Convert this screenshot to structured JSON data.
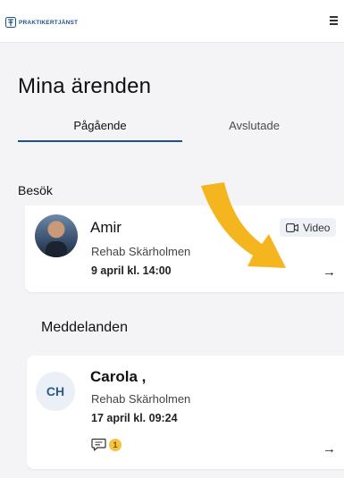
{
  "brand": {
    "name": "PRAKTIKERTJÄNST"
  },
  "page": {
    "title": "Mina ärenden"
  },
  "tabs": [
    {
      "label": "Pågående",
      "active": true
    },
    {
      "label": "Avslutade",
      "active": false
    }
  ],
  "visits": {
    "heading": "Besök",
    "items": [
      {
        "name": "Amir",
        "clinic": "Rehab Skärholmen",
        "datetime": "9 april kl. 14:00",
        "badge": "Video",
        "arrow": "→"
      }
    ]
  },
  "messages": {
    "heading": "Meddelanden",
    "items": [
      {
        "initials": "CH",
        "name": "Carola ,",
        "clinic": "Rehab Skärholmen",
        "datetime": "17 april kl. 09:24",
        "unread_count": "1",
        "arrow": "→"
      }
    ]
  },
  "colors": {
    "accent": "#1e4f8f",
    "annotation": "#f5b51e",
    "badge": "#f5c242"
  }
}
